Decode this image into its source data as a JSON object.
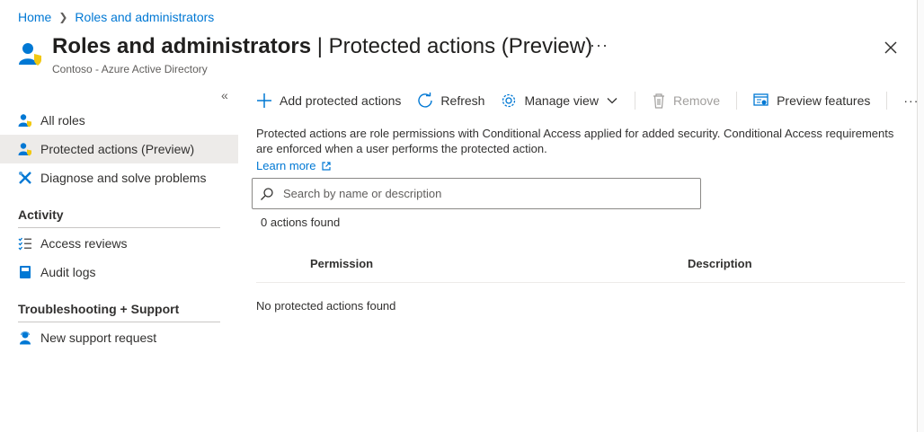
{
  "breadcrumb": {
    "home": "Home",
    "current": "Roles and administrators"
  },
  "header": {
    "title_main": "Roles and administrators",
    "title_separator": " | ",
    "title_sub": "Protected actions (Preview)",
    "more": "···",
    "subtitle": "Contoso - Azure Active Directory"
  },
  "sidebar": {
    "collapse": "«",
    "items": [
      {
        "label": "All roles",
        "icon": "roles-icon"
      },
      {
        "label": "Protected actions (Preview)",
        "icon": "protected-actions-icon",
        "active": true
      },
      {
        "label": "Diagnose and solve problems",
        "icon": "diagnose-icon"
      }
    ],
    "sections": [
      {
        "title": "Activity",
        "items": [
          {
            "label": "Access reviews",
            "icon": "access-reviews-icon"
          },
          {
            "label": "Audit logs",
            "icon": "audit-logs-icon"
          }
        ]
      },
      {
        "title": "Troubleshooting + Support",
        "items": [
          {
            "label": "New support request",
            "icon": "support-request-icon"
          }
        ]
      }
    ]
  },
  "toolbar": {
    "add": "Add protected actions",
    "refresh": "Refresh",
    "manage_view": "Manage view",
    "remove": "Remove",
    "preview_features": "Preview features",
    "more": "···"
  },
  "content": {
    "description": "Protected actions are role permissions with Conditional Access applied for added security. Conditional Access requirements are enforced when a user performs the protected action.",
    "learn_more": "Learn more",
    "search_placeholder": "Search by name or description",
    "count_text": "0 actions found",
    "columns": [
      "Permission",
      "Description"
    ],
    "empty_text": "No protected actions found"
  },
  "colors": {
    "accent": "#0078d4",
    "active_bg": "#edebe9",
    "text": "#323130",
    "muted": "#605e5c"
  }
}
